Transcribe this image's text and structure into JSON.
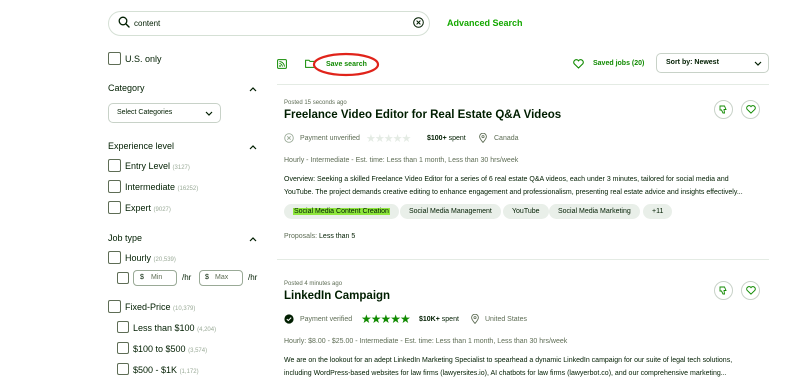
{
  "search": {
    "value": "content",
    "advanced_label": "Advanced Search"
  },
  "filters": {
    "us_only": "U.S. only",
    "category": {
      "title": "Category",
      "select_label": "Select Categories"
    },
    "experience": {
      "title": "Experience level",
      "items": [
        {
          "label": "Entry Level",
          "count": "(3127)"
        },
        {
          "label": "Intermediate",
          "count": "(16252)"
        },
        {
          "label": "Expert",
          "count": "(9027)"
        }
      ]
    },
    "job_type": {
      "title": "Job type",
      "hourly": {
        "label": "Hourly",
        "count": "(20,539)"
      },
      "min_placeholder": "Min",
      "max_placeholder": "Max",
      "currency": "$",
      "per_hr": "/hr",
      "fixed": {
        "label": "Fixed-Price",
        "count": "(10,379)"
      },
      "fixed_items": [
        {
          "label": "Less than $100",
          "count": "(4,204)"
        },
        {
          "label": "$100 to $500",
          "count": "(3,574)"
        },
        {
          "label": "$500 - $1K",
          "count": "(1,172)"
        }
      ]
    }
  },
  "toolbar": {
    "save_search": "Save search",
    "saved_jobs": "Saved jobs (20)",
    "sort": "Sort by: Newest"
  },
  "jobs": [
    {
      "posted": "Posted 15 seconds ago",
      "title": "Freelance Video Editor for Real Estate Q&A Videos",
      "payment": "Payment unverified",
      "spent": "$100+",
      "spent_label": "spent",
      "location": "Canada",
      "details": "Hourly - Intermediate - Est. time: Less than 1 month, Less than 30 hrs/week",
      "desc_line1": "Overview: Seeking a skilled Freelance Video Editor for a series of 6 real estate Q&A videos, each under 3 minutes, tailored for social media and",
      "desc_line2": "YouTube. The project demands creative editing to enhance engagement and professionalism, presenting real estate advice and insights effectively...",
      "skills": [
        "Social Media Content Creation",
        "Social Media Management",
        "YouTube",
        "Social Media Marketing",
        "+11"
      ],
      "proposals_label": "Proposals:",
      "proposals_value": "Less than 5",
      "rating": 0
    },
    {
      "posted": "Posted 4 minutes ago",
      "title": "LinkedIn Campaign",
      "payment": "Payment verified",
      "spent": "$10K+",
      "spent_label": "spent",
      "location": "United States",
      "details": "Hourly: $8.00 - $25.00 - Intermediate - Est. time: Less than 1 month, Less than 30 hrs/week",
      "desc_line1": "We are on the lookout for an adept LinkedIn Marketing Specialist to spearhead a dynamic LinkedIn campaign for our suite of legal tech solutions,",
      "desc_line2": "including WordPress-based websites for law firms (lawyersites.io), AI chatbots for law firms (lawyerbot.co), and our comprehensive marketing...",
      "rating": 5
    }
  ],
  "colors": {
    "brand": "#14a800",
    "annotation": "#e0231a",
    "highlight": "#8ee63c"
  }
}
